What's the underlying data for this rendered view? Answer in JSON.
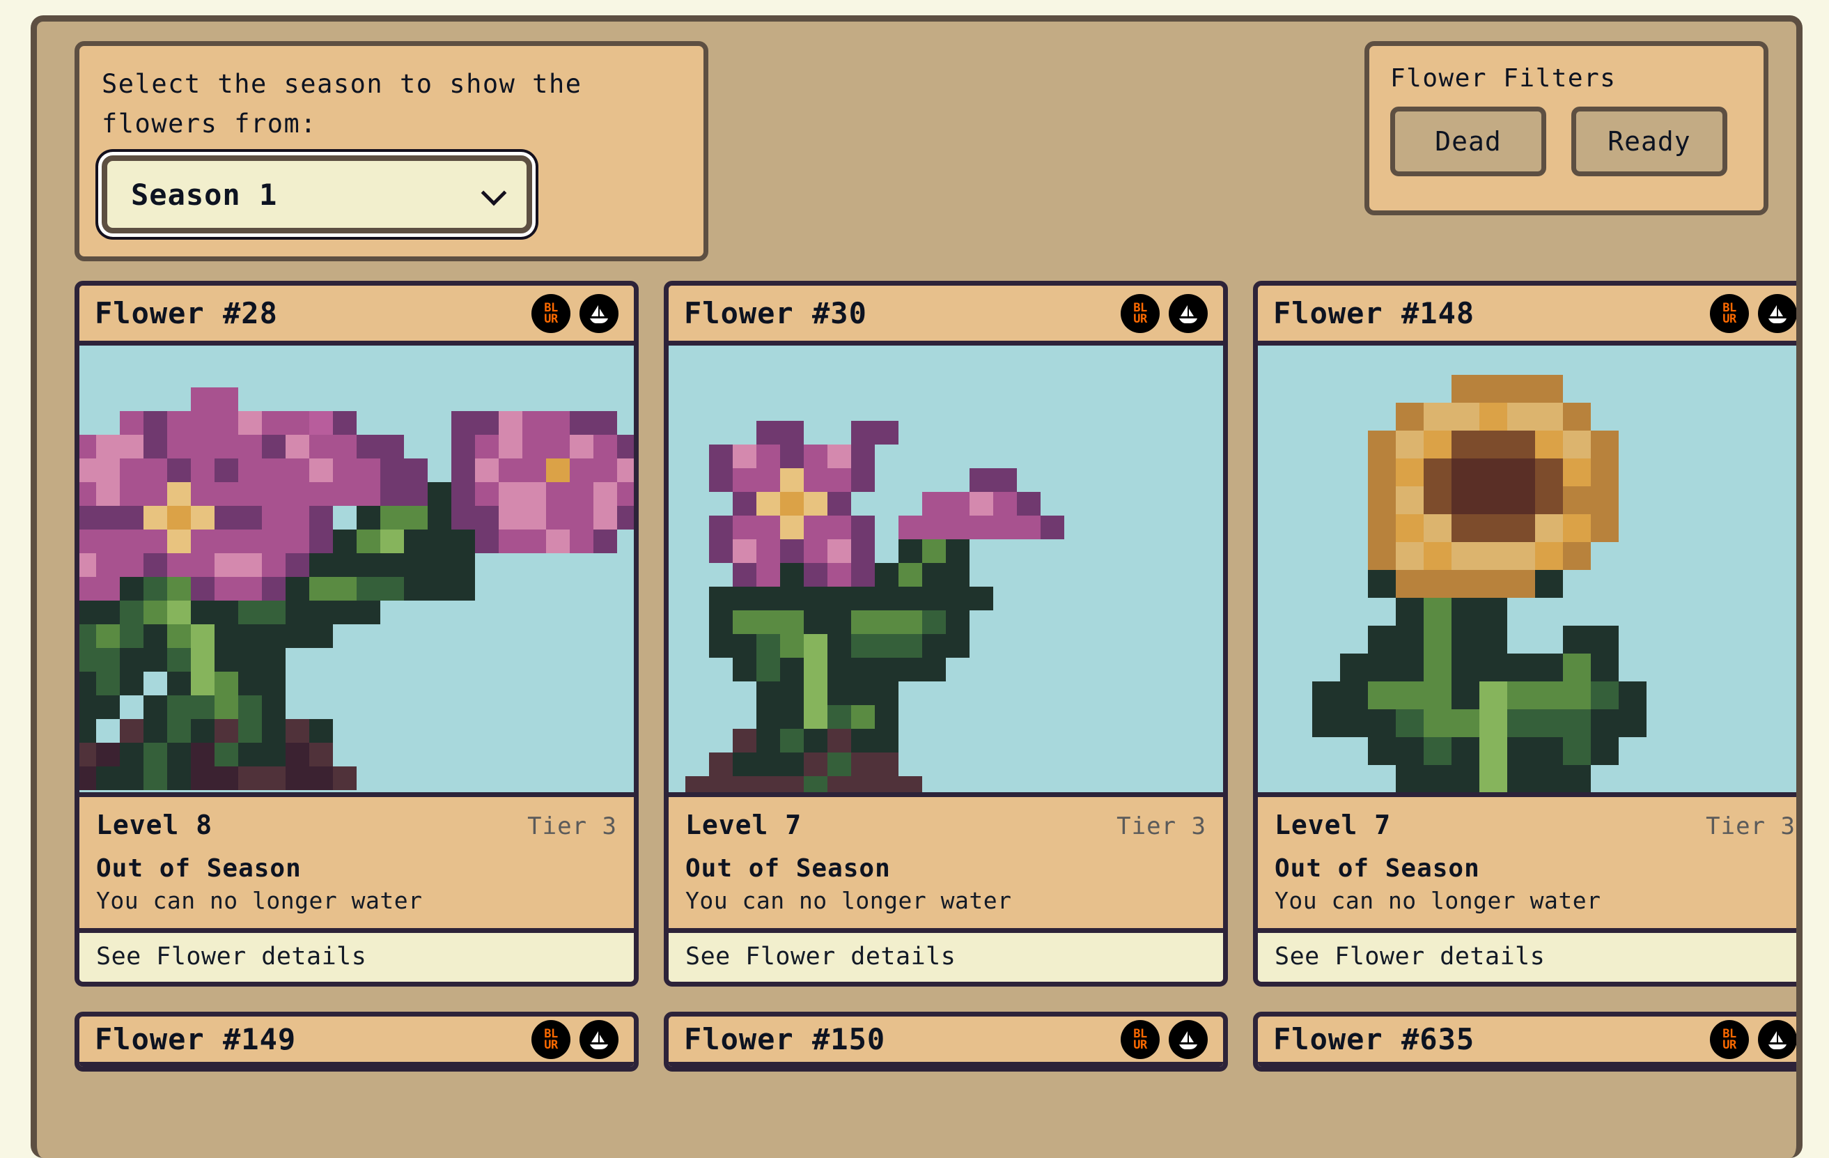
{
  "colors": {
    "page_bg": "#f8f7e4",
    "frame_border": "#5d4f42",
    "frame_bg": "#c3ab84",
    "panel_bg": "#e7c08c",
    "card_border": "#2d2339",
    "art_bg": "#a8d8dc",
    "footer_bg": "#f2efcd",
    "text_dark": "#0d1321",
    "tier_gray": "#5a5a5a",
    "blur_orange": "#ff6a00"
  },
  "season_panel": {
    "label": "Select the season to show the\nflowers from:",
    "selected_value": "Season 1",
    "chevron_icon": "chevron-down-icon",
    "options": [
      "Season 1"
    ]
  },
  "filters_panel": {
    "title": "Flower Filters",
    "buttons": [
      {
        "label": "Dead"
      },
      {
        "label": "Ready"
      }
    ]
  },
  "market_icons": [
    {
      "name": "blur-icon",
      "text_top": "BL",
      "text_bottom": "UR"
    },
    {
      "name": "opensea-icon",
      "glyph": "sailboat"
    }
  ],
  "cards": [
    {
      "title": "Flower #28",
      "level": "Level 8",
      "tier": "Tier 3",
      "status": "Out of Season",
      "status_sub": "You can no longer water",
      "footer": "See Flower details",
      "art": "flower_28"
    },
    {
      "title": "Flower #30",
      "level": "Level 7",
      "tier": "Tier 3",
      "status": "Out of Season",
      "status_sub": "You can no longer water",
      "footer": "See Flower details",
      "art": "flower_30"
    },
    {
      "title": "Flower #148",
      "level": "Level 7",
      "tier": "Tier 3",
      "status": "Out of Season",
      "status_sub": "You can no longer water",
      "footer": "See Flower details",
      "art": "flower_148"
    }
  ],
  "cards_row2": [
    {
      "title": "Flower #149"
    },
    {
      "title": "Flower #150"
    },
    {
      "title": "Flower #635"
    }
  ],
  "art_palettes": {
    "_": "transparent",
    "P": "#a8528f",
    "p": "#d489ae",
    "M": "#b85d9c",
    "D": "#70396f",
    "Y": "#e8c37f",
    "O": "#dba247",
    "G": "#5a8b42",
    "g": "#86b45c",
    "F": "#35603a",
    "K": "#1f332c",
    "S": "#3b2231",
    "s": "#50323a",
    "T": "#b8823c",
    "t": "#dcb46e",
    "n": "#7d4c2c",
    "N": "#5a2f26"
  },
  "art_sprites": {
    "flower_28": [
      "_________PP_________________DD__",
      "______PDPPPpPPMD____DDpPPDD_____",
      "____PppDPPPPDpPPDD__DPpPPpPD____",
      "___DppPPDPDPPPpPPDD_DpPPOPPpD___",
      "___PPpPPYPPPPPPPPDDKDPppPPpPD___",
      "___PDDDYOYDDPPD_KGGKDDppPPpD____",
      "___PPPPPYPPPPPDKGgKKKDPPpPD_____",
      "___PpPPDPPppPDKKKKKKK___________",
      "___DPPKFGDPPDKGGFFKKK___________",
      "____KKFGgKKFFKKKK_______________",
      "___KFGFKGgKKKKK_________________",
      "__KGFFKKFgKKK___________________",
      "__KKKFK_KgGKK___________________",
      "__KKKK_KFFGFK___________________",
      "___KK_sKFKsFKsK_________________",
      "____sSKFKSFKKSs_________________",
      "__ssSKKFKSSssSSs________________"
    ],
    "flower_30": [
      "____DD__DD______________",
      "__DpPDPpD_______________",
      "__DPPYPPD____DD_________",
      "___DYOYD___PPpPD________",
      "__DPPYPPD_PPPPPPD_______",
      "__DpPDPpD_KGK___________",
      "___DPKDPDKGKK___________",
      "__KKKKKKKKKKKK__________",
      "__KGGGKKGGGFK___________",
      "__KKFGgKFFFKK___________",
      "___KFKgKKKKK____________",
      "____KKgKKK______________",
      "____KKgFGK______________",
      "___sKFKsKK______________",
      "__sKKKsFss______________",
      "_sssssFssss_____________"
    ],
    "flower_148": [
      "_____TTTT_______",
      "___TttOttT______",
      "__TtOnnnOtT_____",
      "__TOnNNNnOT_____",
      "__TtnNNNnTT_____",
      "__TOtnnntOT_____",
      "__TtOtttOT______",
      "__KTTTTTK_______",
      "___KGKK_________",
      "__KKGKK__KK_____",
      "_KKKGKKKKGK_____",
      "KKGGGKgGGGFK____",
      "KKKFGGgFFFKK____",
      "__KKFKgKKFK_____",
      "___KKKgKKK______",
      "____KKgFGK______",
      "___sKsFKsK______",
      "__sSKFKsSSs_____",
      "_ssssssssss_____"
    ]
  }
}
